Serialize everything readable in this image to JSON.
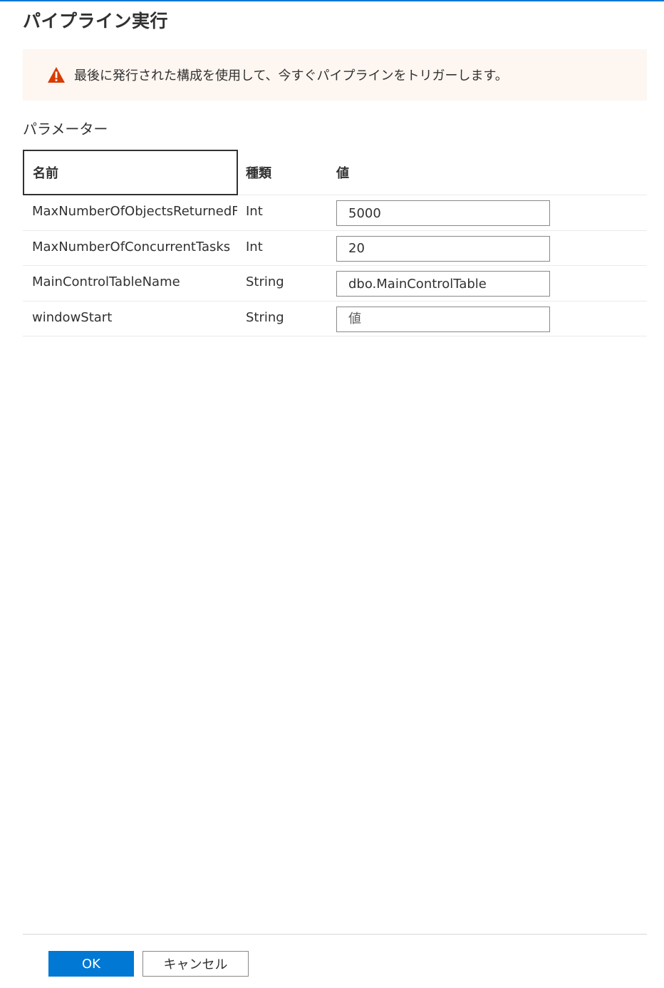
{
  "dialog": {
    "title": "パイプライン実行",
    "accent_color": "#0078d4"
  },
  "banner": {
    "icon": "warning-icon",
    "icon_color": "#d83b01",
    "message": "最後に発行された構成を使用して、今すぐパイプラインをトリガーします。"
  },
  "parameters": {
    "label": "パラメーター",
    "columns": {
      "name": "名前",
      "type": "種類",
      "value": "値"
    },
    "rows": [
      {
        "name": "MaxNumberOfObjectsReturnedFr",
        "type": "Int",
        "value": "5000",
        "placeholder": ""
      },
      {
        "name": "MaxNumberOfConcurrentTasks",
        "type": "Int",
        "value": "20",
        "placeholder": ""
      },
      {
        "name": "MainControlTableName",
        "type": "String",
        "value": "dbo.MainControlTable",
        "placeholder": ""
      },
      {
        "name": "windowStart",
        "type": "String",
        "value": "",
        "placeholder": "値"
      }
    ]
  },
  "footer": {
    "ok_label": "OK",
    "cancel_label": "キャンセル"
  }
}
